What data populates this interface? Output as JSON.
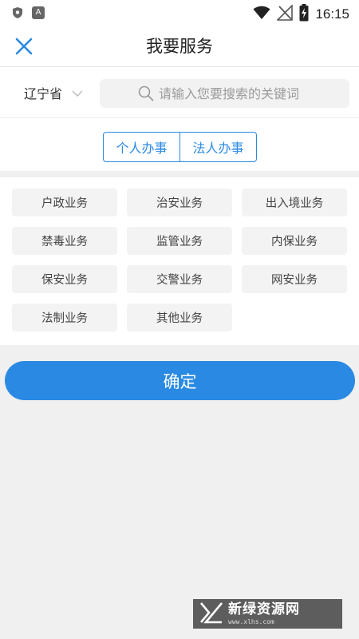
{
  "status_bar": {
    "time": "16:15",
    "left_icons": [
      "shield-icon",
      "a-badge-icon"
    ],
    "right_icons": [
      "wifi-icon",
      "no-signal-icon",
      "battery-charging-icon"
    ]
  },
  "header": {
    "title": "我要服务",
    "close_icon": "close-icon"
  },
  "search": {
    "province": "辽宁省",
    "placeholder": "请输入您要搜索的关键词"
  },
  "tabs": [
    {
      "label": "个人办事"
    },
    {
      "label": "法人办事"
    }
  ],
  "services": [
    {
      "label": "户政业务"
    },
    {
      "label": "治安业务"
    },
    {
      "label": "出入境业务"
    },
    {
      "label": "禁毒业务"
    },
    {
      "label": "监管业务"
    },
    {
      "label": "内保业务"
    },
    {
      "label": "保安业务"
    },
    {
      "label": "交警业务"
    },
    {
      "label": "网安业务"
    },
    {
      "label": "法制业务"
    },
    {
      "label": "其他业务"
    }
  ],
  "confirm_label": "确定",
  "watermark": {
    "title": "新绿资源网",
    "url": "www.xlhs.com"
  },
  "colors": {
    "accent": "#2a8ae3",
    "background": "#f0f0f0"
  }
}
